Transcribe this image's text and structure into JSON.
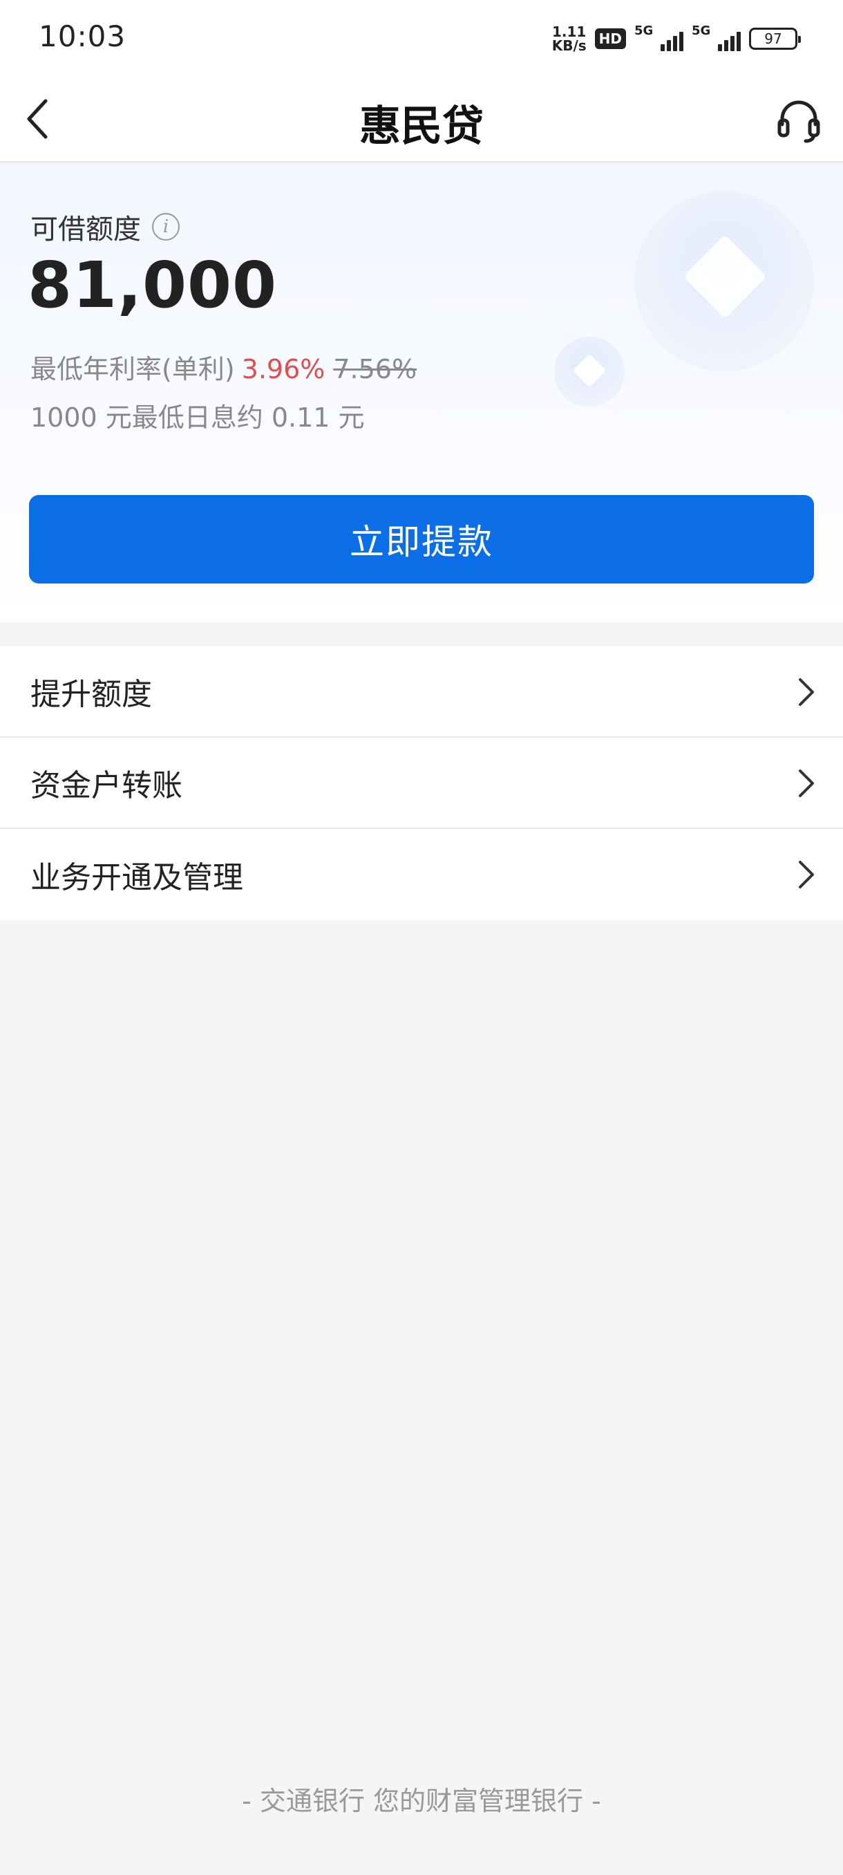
{
  "status_bar": {
    "time": "10:03",
    "net_speed_value": "1.11",
    "net_speed_unit": "KB/s",
    "hd_label": "HD",
    "signal1_label": "5G",
    "signal2_label": "5G",
    "battery": "97"
  },
  "header": {
    "title": "惠民贷"
  },
  "credit": {
    "label": "可借额度",
    "amount": "81,000",
    "rate_prefix": "最低年利率(单利)",
    "rate_new": "3.96%",
    "rate_old": "7.56%",
    "interest_text": "1000 元最低日息约 0.11 元",
    "withdraw_label": "立即提款"
  },
  "menu": {
    "items": [
      {
        "label": "提升额度"
      },
      {
        "label": "资金户转账"
      },
      {
        "label": "业务开通及管理"
      }
    ]
  },
  "footer": {
    "text": "- 交通银行 您的财富管理银行 -"
  },
  "colors": {
    "accent": "#0b6ee6",
    "rate_highlight": "#e24c4c",
    "page_bg": "#f5f5f5"
  },
  "icons": {
    "back": "chevron-left-icon",
    "service": "headset-icon",
    "info": "info-icon",
    "menu_arrow": "chevron-right-icon"
  }
}
